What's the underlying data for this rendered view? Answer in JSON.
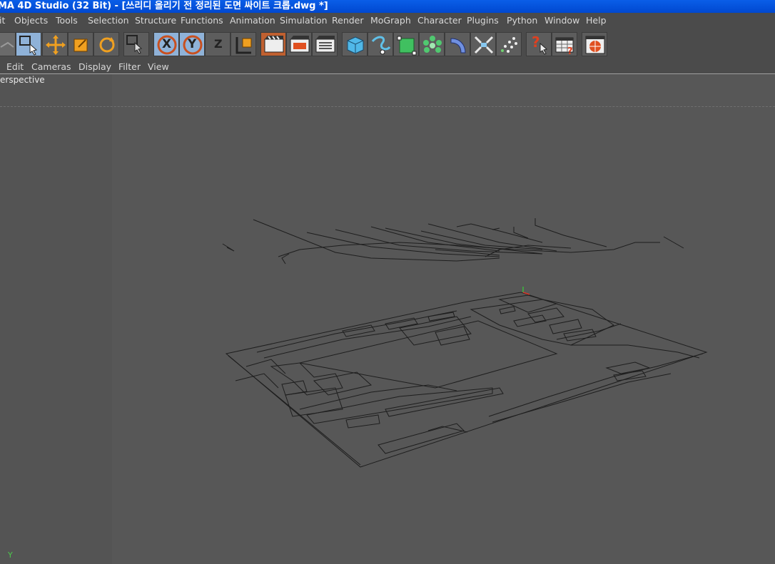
{
  "window": {
    "title": "MA 4D Studio (32 Bit) - [쓰리디 올리기 전 정리된 도면 싸이트 크롭.dwg *]"
  },
  "menubar": {
    "items": [
      "it",
      "Objects",
      "Tools",
      "Selection",
      "Structure",
      "Functions",
      "Animation",
      "Simulation",
      "Render",
      "MoGraph",
      "Character",
      "Plugins",
      "Python",
      "Window",
      "Help"
    ]
  },
  "toolbar": {
    "buttons": [
      {
        "name": "undo-icon"
      },
      {
        "name": "live-selection-icon"
      },
      {
        "name": "move-icon"
      },
      {
        "name": "scale-icon"
      },
      {
        "name": "rotate-icon"
      },
      {
        "name": "selection-tool-icon"
      },
      {
        "name": "x-axis-icon"
      },
      {
        "name": "y-axis-icon"
      },
      {
        "name": "z-axis-icon"
      },
      {
        "name": "coordinate-system-icon"
      },
      {
        "name": "render-view-icon"
      },
      {
        "name": "render-picture-viewer-icon"
      },
      {
        "name": "render-settings-icon"
      },
      {
        "name": "cube-icon"
      },
      {
        "name": "spline-icon"
      },
      {
        "name": "nurbs-icon"
      },
      {
        "name": "array-icon"
      },
      {
        "name": "deformer-icon"
      },
      {
        "name": "scene-icon"
      },
      {
        "name": "particles-icon"
      },
      {
        "name": "help-icon"
      },
      {
        "name": "table-icon"
      },
      {
        "name": "web-icon"
      }
    ],
    "axis_labels": {
      "x": "X",
      "y": "Y",
      "z": "Z"
    }
  },
  "viewport_menu": {
    "items": [
      "Edit",
      "Cameras",
      "Display",
      "Filter",
      "View"
    ]
  },
  "viewport": {
    "label": "erspective",
    "axis_y": "Y",
    "colors": {
      "background": "#575757",
      "wire": "#1e1e1e"
    }
  }
}
